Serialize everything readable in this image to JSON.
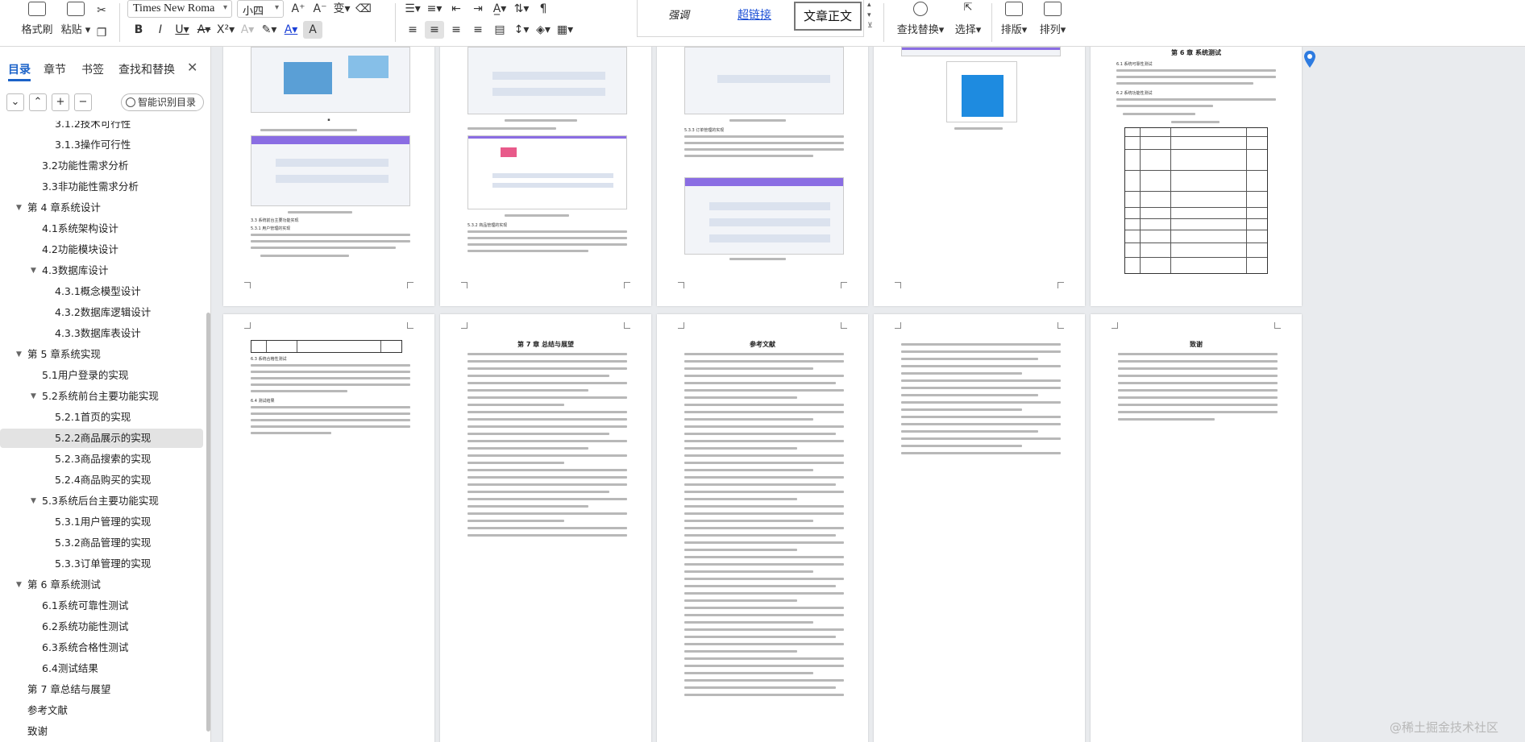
{
  "ribbon": {
    "format_painter": "格式刷",
    "paste": "粘贴",
    "font_name": "Times New Roma",
    "font_size": "小四",
    "styles": [
      "强调",
      "超链接",
      "文章正文"
    ],
    "find_replace": "查找替换",
    "select": "选择",
    "layout": "排版",
    "arrange": "排列"
  },
  "nav": {
    "tabs": [
      "目录",
      "章节",
      "书签",
      "查找和替换"
    ],
    "smart_toc": "智能识别目录",
    "toc": [
      {
        "label": "3.1.2技术可行性",
        "level": 3
      },
      {
        "label": "3.1.3操作可行性",
        "level": 3
      },
      {
        "label": "3.2功能性需求分析",
        "level": 2
      },
      {
        "label": "3.3非功能性需求分析",
        "level": 2
      },
      {
        "label": "第 4 章系统设计",
        "level": 1,
        "expanded": true
      },
      {
        "label": "4.1系统架构设计",
        "level": 2
      },
      {
        "label": "4.2功能模块设计",
        "level": 2
      },
      {
        "label": "4.3数据库设计",
        "level": 2,
        "expanded": true
      },
      {
        "label": "4.3.1概念模型设计",
        "level": 3
      },
      {
        "label": "4.3.2数据库逻辑设计",
        "level": 3
      },
      {
        "label": "4.3.3数据库表设计",
        "level": 3
      },
      {
        "label": "第 5 章系统实现",
        "level": 1,
        "expanded": true
      },
      {
        "label": "5.1用户登录的实现",
        "level": 2
      },
      {
        "label": "5.2系统前台主要功能实现",
        "level": 2,
        "expanded": true
      },
      {
        "label": "5.2.1首页的实现",
        "level": 3
      },
      {
        "label": "5.2.2商品展示的实现",
        "level": 3,
        "selected": true
      },
      {
        "label": "5.2.3商品搜索的实现",
        "level": 3
      },
      {
        "label": "5.2.4商品购买的实现",
        "level": 3
      },
      {
        "label": "5.3系统后台主要功能实现",
        "level": 2,
        "expanded": true
      },
      {
        "label": "5.3.1用户管理的实现",
        "level": 3
      },
      {
        "label": "5.3.2商品管理的实现",
        "level": 3
      },
      {
        "label": "5.3.3订单管理的实现",
        "level": 3
      },
      {
        "label": "第 6 章系统测试",
        "level": 1,
        "expanded": true
      },
      {
        "label": "6.1系统可靠性测试",
        "level": 2
      },
      {
        "label": "6.2系统功能性测试",
        "level": 2
      },
      {
        "label": "6.3系统合格性测试",
        "level": 2
      },
      {
        "label": "6.4测试结果",
        "level": 2
      },
      {
        "label": "第 7 章总结与展望",
        "level": 1
      },
      {
        "label": "参考文献",
        "level": 1
      },
      {
        "label": "致谢",
        "level": 1
      }
    ]
  },
  "pages": {
    "p1": {
      "section": "3.3 系统前台主要功能实现",
      "subsection": "5.3.1 用户管理的实现"
    },
    "p2": {
      "section": "5.3.2 商品管理的实现"
    },
    "p3": {
      "section": "5.3.3 订单管理的实现"
    },
    "p5": {
      "title": "第 6 章  系统测试",
      "s1": "6.1 系统可靠性测试",
      "s2": "6.2 系统功能性测试"
    },
    "p6": {
      "s1": "6.3 系统合格性测试",
      "s2": "6.4 测试结果"
    },
    "p7": {
      "title": "第 7 章  总结与展望"
    },
    "p8": {
      "title": "参考文献"
    },
    "p10": {
      "title": "致谢"
    }
  },
  "watermark": "@稀土掘金技术社区"
}
